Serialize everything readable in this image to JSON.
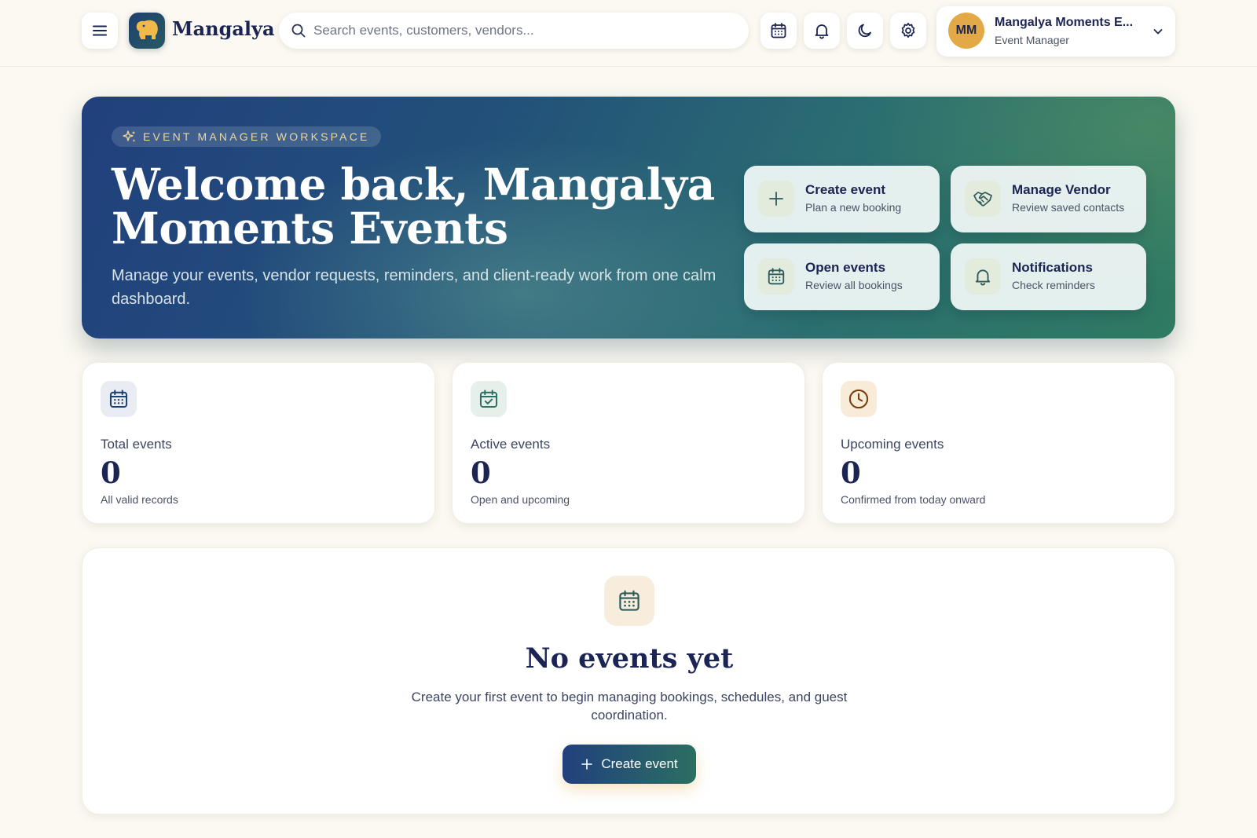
{
  "header": {
    "brand": "Mangalya",
    "search_placeholder": "Search events, customers, vendors...",
    "search_value": "",
    "user": {
      "initials": "MM",
      "name": "Mangalya Moments E...",
      "role": "Event Manager"
    }
  },
  "hero": {
    "badge": "EVENT MANAGER WORKSPACE",
    "title": "Welcome back, Mangalya Moments Events",
    "subtitle": "Manage your events, vendor requests, reminders, and client-ready work from one calm dashboard.",
    "actions": [
      {
        "title": "Create event",
        "subtitle": "Plan a new booking",
        "icon": "plus-icon"
      },
      {
        "title": "Manage Vendor",
        "subtitle": "Review saved contacts",
        "icon": "handshake-icon"
      },
      {
        "title": "Open events",
        "subtitle": "Review all bookings",
        "icon": "calendar-icon"
      },
      {
        "title": "Notifications",
        "subtitle": "Check reminders",
        "icon": "bell-icon"
      }
    ]
  },
  "stats": [
    {
      "label": "Total events",
      "value": "0",
      "sub": "All valid records",
      "icon": "calendar-icon",
      "color": "#1f3f6e",
      "bg": "#e9edf3"
    },
    {
      "label": "Active events",
      "value": "0",
      "sub": "Open and upcoming",
      "icon": "calendar-check-icon",
      "color": "#2f6e62",
      "bg": "#e6efe9"
    },
    {
      "label": "Upcoming events",
      "value": "0",
      "sub": "Confirmed from today onward",
      "icon": "clock-icon",
      "color": "#7a3d12",
      "bg": "#f8ecd9"
    }
  ],
  "empty_state": {
    "title": "No events yet",
    "description": "Create your first event to begin managing bookings, schedules, and guest coordination.",
    "button": "Create event"
  },
  "colors": {
    "background": "#fbf9f1",
    "navy": "#1b2452",
    "accent_gold": "#e4a947",
    "hero_start": "#21407d",
    "hero_end": "#2f7a62"
  }
}
